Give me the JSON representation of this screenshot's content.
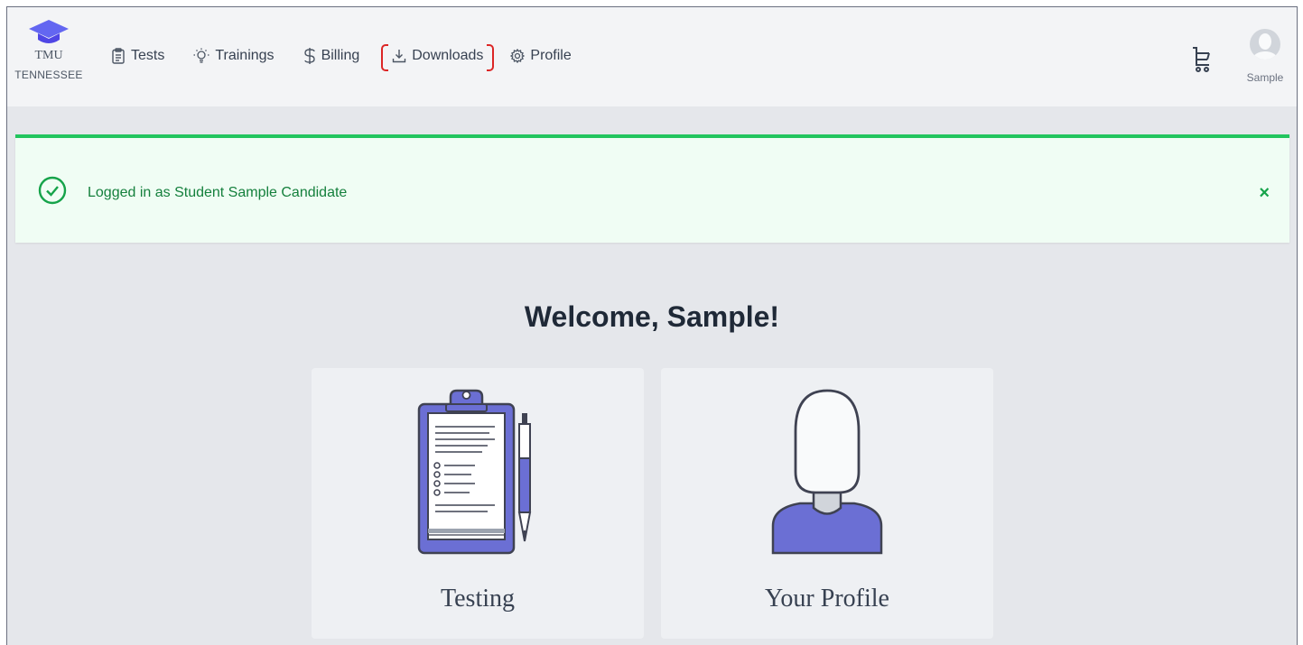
{
  "brand": {
    "line1": "TMU",
    "line2": "TENNESSEE",
    "accent": "#6366f1"
  },
  "nav": {
    "items": [
      {
        "label": "Tests",
        "icon": "clipboard-icon"
      },
      {
        "label": "Trainings",
        "icon": "lightbulb-icon"
      },
      {
        "label": "Billing",
        "icon": "dollar-icon"
      },
      {
        "label": "Downloads",
        "icon": "download-icon",
        "highlighted": true
      },
      {
        "label": "Profile",
        "icon": "gear-icon"
      }
    ],
    "highlight_color": "#dc2626"
  },
  "user": {
    "name": "Sample",
    "cart_icon": "cart-icon",
    "avatar_icon": "avatar-icon"
  },
  "alert": {
    "message": "Logged in as Student Sample Candidate",
    "close": "×",
    "status_color": "#22c55e"
  },
  "main": {
    "welcome": "Welcome, Sample!",
    "cards": [
      {
        "label": "Testing",
        "icon": "clipboard-illustration"
      },
      {
        "label": "Your Profile",
        "icon": "person-illustration"
      }
    ]
  }
}
